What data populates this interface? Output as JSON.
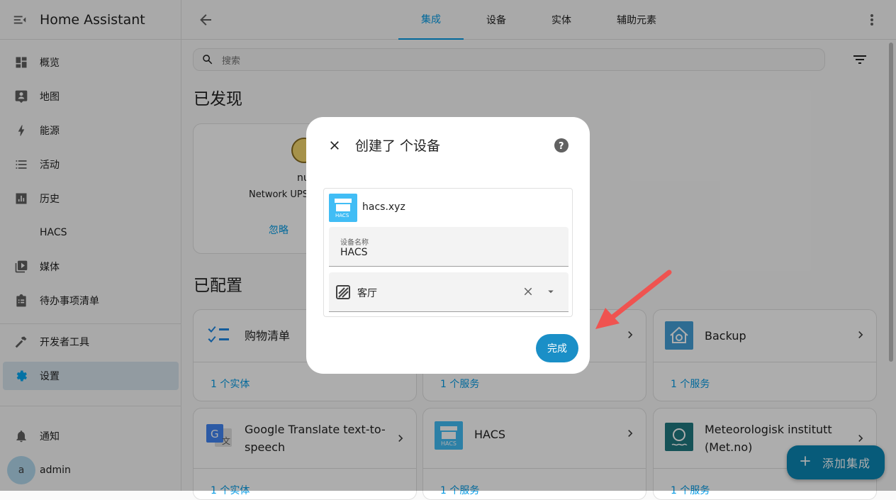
{
  "app": {
    "title": "Home Assistant"
  },
  "sidebar": {
    "items": [
      {
        "label": "概览",
        "icon": "dashboard-icon"
      },
      {
        "label": "地图",
        "icon": "map-icon"
      },
      {
        "label": "能源",
        "icon": "lightning-icon"
      },
      {
        "label": "活动",
        "icon": "list-icon"
      },
      {
        "label": "历史",
        "icon": "chart-icon"
      },
      {
        "label": "HACS",
        "icon": ""
      },
      {
        "label": "媒体",
        "icon": "play-box-icon"
      },
      {
        "label": "待办事项清单",
        "icon": "clipboard-icon"
      },
      {
        "label": "开发者工具",
        "icon": "hammer-icon"
      },
      {
        "label": "设置",
        "icon": "gear-icon"
      }
    ],
    "notifications_label": "通知",
    "user": {
      "initial": "a",
      "name": "admin"
    }
  },
  "tabs": [
    "集成",
    "设备",
    "实体",
    "辅助元素"
  ],
  "search": {
    "placeholder": "搜索"
  },
  "sections": {
    "discovered": "已发现",
    "configured": "已配置"
  },
  "discovered_card": {
    "name": "nu",
    "subtitle": "Network UPS",
    "ignore_label": "忽略"
  },
  "cards": [
    {
      "name": "购物清单",
      "footer": "1 个实体"
    },
    {
      "name": "",
      "footer": "1 个服务"
    },
    {
      "name": "Backup",
      "footer": "1 个服务"
    },
    {
      "name": "Google Translate text-to-speech",
      "footer": "1 个实体"
    },
    {
      "name": "HACS",
      "footer": "1 个服务"
    },
    {
      "name": "Meteorologisk institutt (Met.no)",
      "footer": "1 个服务"
    }
  ],
  "fab": {
    "label": "添加集成"
  },
  "dialog": {
    "title": "创建了 个设备",
    "device": "hacs.xyz",
    "device_name_label": "设备名称",
    "device_name_value": "HACS",
    "area_value": "客厅",
    "done_label": "完成",
    "hacs_logo_text": "HACS"
  },
  "colors": {
    "accent": "#039be5",
    "active_bg": "#d8e5ee",
    "arrow": "#ef5350"
  }
}
